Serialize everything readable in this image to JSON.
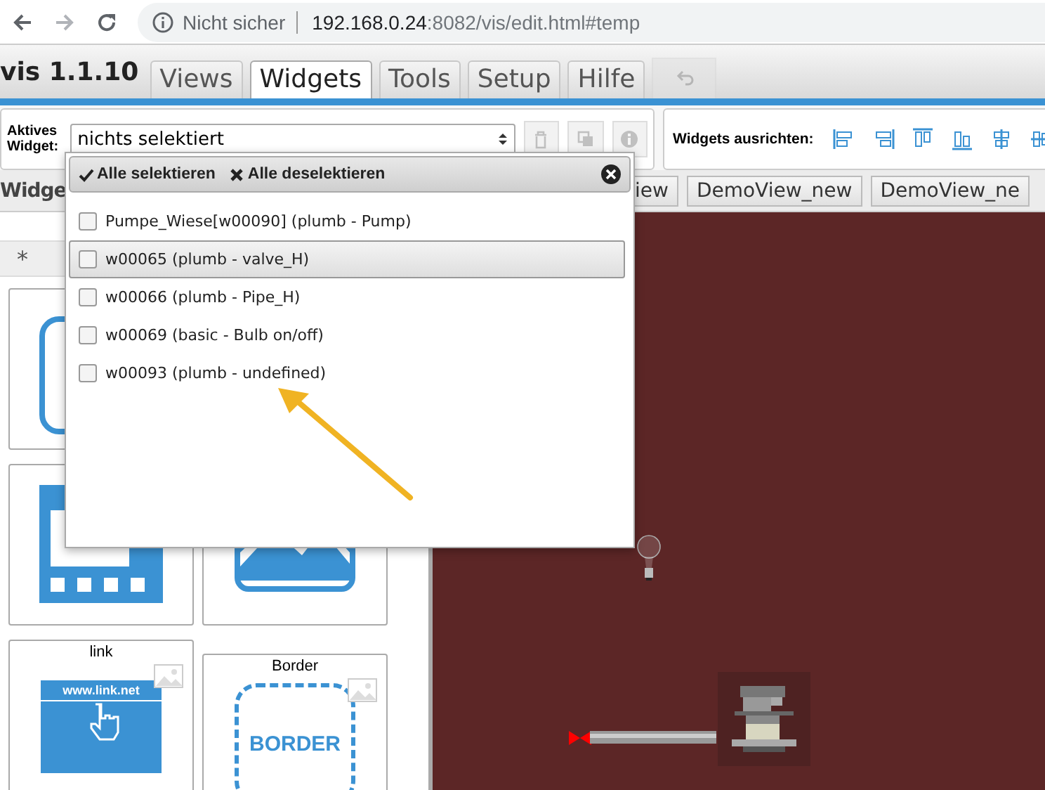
{
  "browser": {
    "security": "Nicht sicher",
    "host": "192.168.0.24",
    "path": ":8082/vis/edit.html#temp"
  },
  "app": {
    "title": "vis 1.1.10"
  },
  "tabs": [
    {
      "label": "Views",
      "selected": false
    },
    {
      "label": "Widgets",
      "selected": true
    },
    {
      "label": "Tools",
      "selected": false
    },
    {
      "label": "Setup",
      "selected": false
    },
    {
      "label": "Hilfe",
      "selected": false
    }
  ],
  "undo_button": {
    "disabled": true
  },
  "active_widget": {
    "label": "Aktives Widget:",
    "value": "nichts selektiert",
    "buttons_disabled": true
  },
  "align": {
    "label": "Widgets ausrichten:"
  },
  "widgets_heading": "Widge",
  "view_tabs": [
    "iew",
    "DemoView_new",
    "DemoView_ne"
  ],
  "filter": "*",
  "widget_cards": [
    {
      "kind": "html"
    },
    {
      "kind": "iframe"
    },
    {
      "kind": "image"
    },
    {
      "kind": "link",
      "label": "link",
      "text": "www.link.net"
    },
    {
      "kind": "border",
      "label": "Border",
      "text": "BORDER"
    }
  ],
  "popup": {
    "select_all": "Alle selektieren",
    "deselect_all": "Alle deselektieren",
    "items": [
      {
        "label": "Pumpe_Wiese[w00090] (plumb - Pump)",
        "checked": false,
        "highlighted": false
      },
      {
        "label": "w00065 (plumb - valve_H)",
        "checked": false,
        "highlighted": true
      },
      {
        "label": "w00066 (plumb - Pipe_H)",
        "checked": false,
        "highlighted": false
      },
      {
        "label": "w00069 (basic - Bulb on/off)",
        "checked": false,
        "highlighted": false
      },
      {
        "label": "w00093 (plumb - undefined)",
        "checked": false,
        "highlighted": false
      }
    ]
  }
}
